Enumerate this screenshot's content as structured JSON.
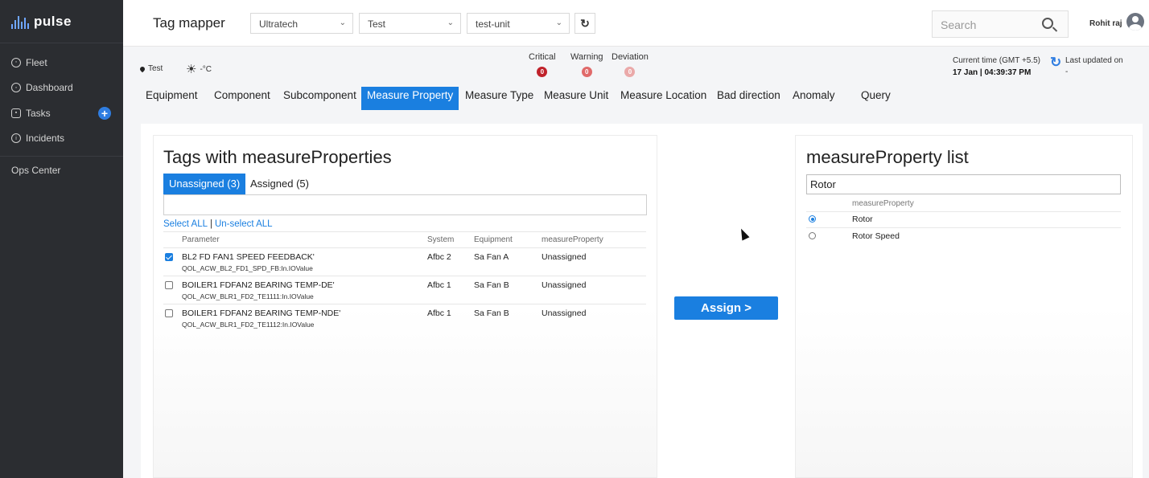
{
  "brand": {
    "name": "pulse"
  },
  "sidebar": {
    "items": [
      {
        "label": "Fleet"
      },
      {
        "label": "Dashboard"
      },
      {
        "label": "Tasks"
      },
      {
        "label": "Incidents"
      },
      {
        "label": "Ops Center"
      }
    ]
  },
  "header": {
    "title": "Tag mapper",
    "selects": [
      "Ultratech",
      "Test",
      "test-unit"
    ],
    "search_placeholder": "Search",
    "user_name": "Rohit raj"
  },
  "status": {
    "location": "Test",
    "temperature": "-°C",
    "alerts": [
      {
        "label": "Critical",
        "count": "0",
        "color": "#c0222b"
      },
      {
        "label": "Warning",
        "count": "0",
        "color": "#e06a6a"
      },
      {
        "label": "Deviation",
        "count": "0",
        "color": "#eaa9a9"
      }
    ],
    "current_time_label": "Current time (GMT +5.5)",
    "current_time_value": "17 Jan | 04:39:37 PM",
    "last_updated_label": "Last updated on",
    "last_updated_value": "-"
  },
  "tabs": [
    {
      "label": "Equipment"
    },
    {
      "label": "Component"
    },
    {
      "label": "Subcomponent"
    },
    {
      "label": "Measure Property",
      "active": true
    },
    {
      "label": "Measure Type"
    },
    {
      "label": "Measure Unit"
    },
    {
      "label": "Measure Location"
    },
    {
      "label": "Bad direction"
    },
    {
      "label": "Anomaly"
    },
    {
      "label": "Query"
    }
  ],
  "left_panel": {
    "title": "Tags with measureProperties",
    "subtabs": [
      "Unassigned (3)",
      "Assigned (5)"
    ],
    "filter_value": "",
    "select_all": "Select ALL",
    "unselect_all": "Un-select ALL",
    "columns": [
      "Parameter",
      "System",
      "Equipment",
      "measureProperty"
    ],
    "rows": [
      {
        "checked": true,
        "name": "BL2 FD FAN1 SPEED FEEDBACK'",
        "tag": "QOL_ACW_BL2_FD1_SPD_FB:In.IOValue",
        "system": "Afbc 2",
        "equipment": "Sa Fan A",
        "measure_property": "Unassigned"
      },
      {
        "checked": false,
        "name": "BOILER1 FDFAN2 BEARING TEMP-DE'",
        "tag": "QOL_ACW_BLR1_FD2_TE1111:In.IOValue",
        "system": "Afbc 1",
        "equipment": "Sa Fan B",
        "measure_property": "Unassigned"
      },
      {
        "checked": false,
        "name": "BOILER1 FDFAN2 BEARING TEMP-NDE'",
        "tag": "QOL_ACW_BLR1_FD2_TE1112:In.IOValue",
        "system": "Afbc 1",
        "equipment": "Sa Fan B",
        "measure_property": "Unassigned"
      }
    ]
  },
  "assign_button": "Assign >",
  "right_panel": {
    "title": "measureProperty list",
    "search_value": "Rotor",
    "column": "measureProperty",
    "items": [
      {
        "label": "Rotor",
        "selected": true
      },
      {
        "label": "Rotor Speed",
        "selected": false
      }
    ]
  }
}
